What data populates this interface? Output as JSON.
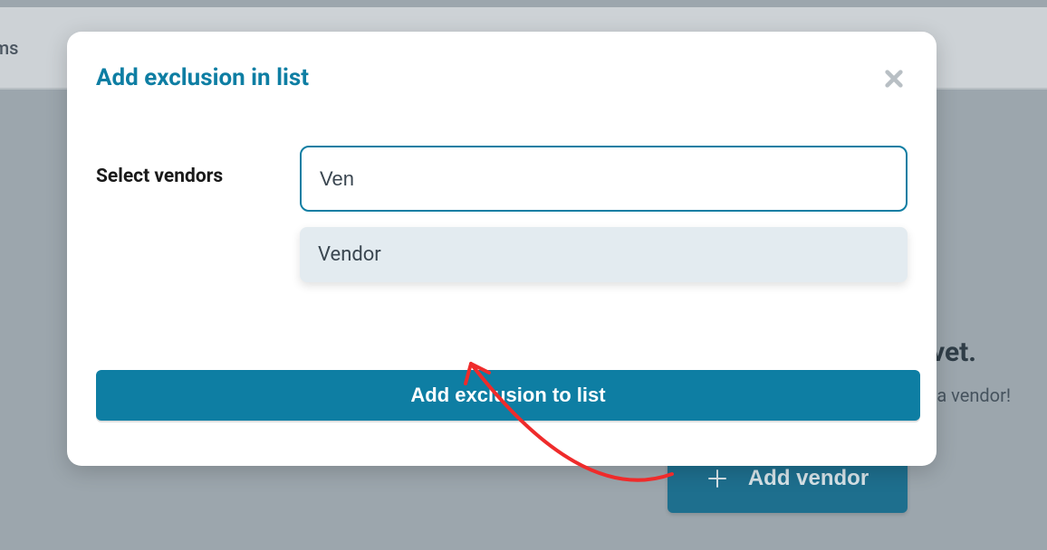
{
  "background": {
    "nav_fragment": "ems",
    "empty_title_fragment": "vet.",
    "empty_subtitle": "Click on the \"Add vendor\" button to add a vendor!",
    "add_vendor_label": "Add vendor"
  },
  "modal": {
    "title": "Add exclusion in list",
    "form": {
      "label": "Select vendors",
      "input_value": "Ven",
      "dropdown_option": "Vendor"
    },
    "submit_label": "Add exclusion to list"
  }
}
